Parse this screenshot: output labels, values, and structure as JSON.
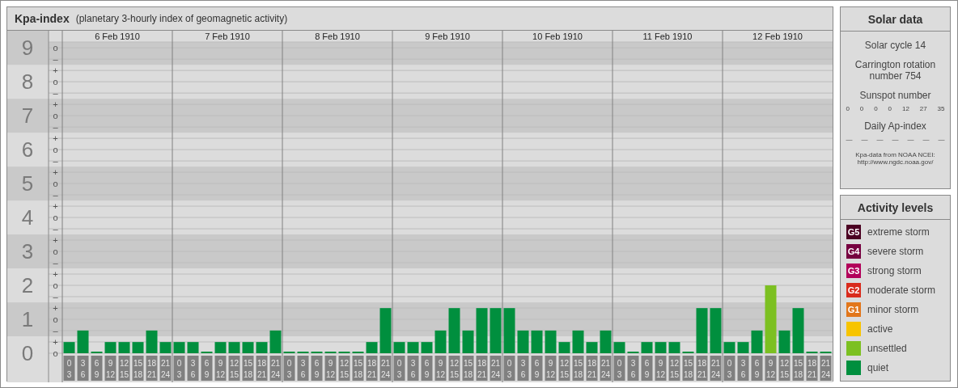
{
  "title": {
    "name": "Kpa-index",
    "description": "(planetary 3-hourly index of geomagnetic activity)"
  },
  "kp_chart": {
    "days": [
      {
        "date": "6 Feb 1910",
        "slots": [
          [
            "0",
            "3"
          ],
          [
            "3",
            "6"
          ],
          [
            "6",
            "9"
          ],
          [
            "9",
            "12"
          ],
          [
            "12",
            "15"
          ],
          [
            "15",
            "18"
          ],
          [
            "18",
            "21"
          ],
          [
            "21",
            "24"
          ]
        ]
      },
      {
        "date": "7 Feb 1910",
        "slots": [
          [
            "0",
            "3"
          ],
          [
            "3",
            "6"
          ],
          [
            "6",
            "9"
          ],
          [
            "9",
            "12"
          ],
          [
            "12",
            "15"
          ],
          [
            "15",
            "18"
          ],
          [
            "18",
            "21"
          ],
          [
            "21",
            "24"
          ]
        ]
      },
      {
        "date": "8 Feb 1910",
        "slots": [
          [
            "0",
            "3"
          ],
          [
            "3",
            "6"
          ],
          [
            "6",
            "9"
          ],
          [
            "9",
            "12"
          ],
          [
            "12",
            "15"
          ],
          [
            "15",
            "18"
          ],
          [
            "18",
            "21"
          ],
          [
            "21",
            "24"
          ]
        ]
      },
      {
        "date": "9 Feb 1910",
        "slots": [
          [
            "0",
            "3"
          ],
          [
            "3",
            "6"
          ],
          [
            "6",
            "9"
          ],
          [
            "9",
            "12"
          ],
          [
            "12",
            "15"
          ],
          [
            "15",
            "18"
          ],
          [
            "18",
            "21"
          ],
          [
            "21",
            "24"
          ]
        ]
      },
      {
        "date": "10 Feb 1910",
        "slots": [
          [
            "0",
            "3"
          ],
          [
            "3",
            "6"
          ],
          [
            "6",
            "9"
          ],
          [
            "9",
            "12"
          ],
          [
            "12",
            "15"
          ],
          [
            "15",
            "18"
          ],
          [
            "18",
            "21"
          ],
          [
            "21",
            "24"
          ]
        ]
      },
      {
        "date": "11 Feb 1910",
        "slots": [
          [
            "0",
            "3"
          ],
          [
            "3",
            "6"
          ],
          [
            "6",
            "9"
          ],
          [
            "9",
            "12"
          ],
          [
            "12",
            "15"
          ],
          [
            "15",
            "18"
          ],
          [
            "18",
            "21"
          ],
          [
            "21",
            "24"
          ]
        ]
      },
      {
        "date": "12 Feb 1910",
        "slots": [
          [
            "0",
            "3"
          ],
          [
            "3",
            "6"
          ],
          [
            "6",
            "9"
          ],
          [
            "9",
            "12"
          ],
          [
            "12",
            "15"
          ],
          [
            "15",
            "18"
          ],
          [
            "18",
            "21"
          ],
          [
            "21",
            "24"
          ]
        ]
      }
    ],
    "sublevel_ticks": [
      "o",
      "–",
      "+",
      "o",
      "–",
      "+",
      "o",
      "–",
      "+",
      "o",
      "–",
      "+",
      "o",
      "–",
      "+",
      "o",
      "–",
      "+",
      "o",
      "–",
      "+",
      "o",
      "–",
      "+",
      "o",
      "–",
      "+",
      "o"
    ],
    "chart_data": {
      "type": "bar",
      "stacked": true,
      "grid": true,
      "ylim": [
        0,
        9.17
      ],
      "yticks": [
        0,
        1,
        2,
        3,
        4,
        5,
        6,
        7,
        8,
        9
      ],
      "series": [
        {
          "name": "quiet",
          "color": "#008f3e",
          "values": [
            0.33,
            0.67,
            0,
            0.33,
            0.33,
            0.33,
            0.67,
            0.33,
            0.33,
            0.33,
            0,
            0.33,
            0.33,
            0.33,
            0.33,
            0.67,
            0,
            0,
            0,
            0,
            0,
            0,
            0.33,
            1.33,
            0.33,
            0.33,
            0.33,
            0.67,
            1.33,
            0.67,
            1.33,
            1.33,
            1.33,
            0.67,
            0.67,
            0.67,
            0.33,
            0.67,
            0.33,
            0.67,
            0.33,
            0,
            0.33,
            0.33,
            0.33,
            0,
            1.33,
            1.33,
            0.33,
            0.33,
            0.67,
            null,
            0.67,
            1.33,
            0,
            0
          ]
        },
        {
          "name": "unsettled",
          "color": "#7cc021",
          "values": [
            null,
            null,
            null,
            null,
            null,
            null,
            null,
            null,
            null,
            null,
            null,
            null,
            null,
            null,
            null,
            null,
            null,
            null,
            null,
            null,
            null,
            null,
            null,
            null,
            null,
            null,
            null,
            null,
            null,
            null,
            null,
            null,
            null,
            null,
            null,
            null,
            null,
            null,
            null,
            null,
            null,
            null,
            null,
            null,
            null,
            null,
            null,
            null,
            null,
            null,
            null,
            2,
            null,
            null,
            null,
            null
          ]
        }
      ]
    }
  },
  "solar_data": {
    "title": "Solar data",
    "solar_cycle": "Solar cycle 14",
    "carrington": "Carrington rotation number 754",
    "sunspot_title": "Sunspot number",
    "sunspot_numbers": [
      "0",
      "0",
      "0",
      "0",
      "12",
      "27",
      "35"
    ],
    "ap_title": "Daily Ap-index",
    "ap_values": [
      "—",
      "—",
      "—",
      "—",
      "—",
      "—",
      "—"
    ],
    "source_lines": [
      "Kpa-data from NOAA NCEI:",
      "http://www.ngdc.noaa.gov/"
    ]
  },
  "activity_levels": {
    "title": "Activity levels",
    "items": [
      {
        "badge": "G5",
        "label": "extreme storm",
        "color": "#4b0022"
      },
      {
        "badge": "G4",
        "label": "severe storm",
        "color": "#760040"
      },
      {
        "badge": "G3",
        "label": "strong storm",
        "color": "#b2005a"
      },
      {
        "badge": "G2",
        "label": "moderate storm",
        "color": "#d92b1c"
      },
      {
        "badge": "G1",
        "label": "minor storm",
        "color": "#e2761a"
      },
      {
        "label": "active",
        "color": "#f7c400"
      },
      {
        "kind": "series"
      },
      {
        "kind": "series"
      }
    ]
  }
}
